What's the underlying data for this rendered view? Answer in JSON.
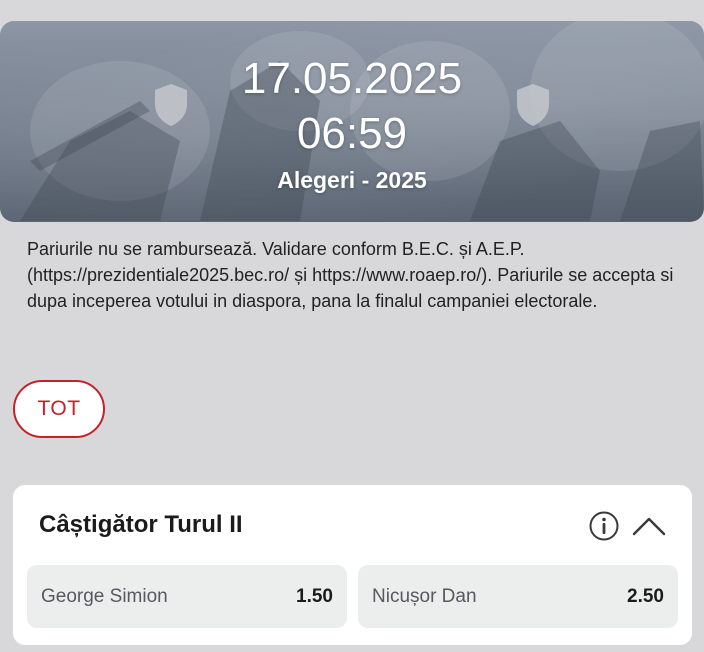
{
  "hero": {
    "date": "17.05.2025",
    "time": "06:59",
    "event_title": "Alegeri - 2025"
  },
  "notice": {
    "text": "Pariurile nu se rambursează. Validare conform B.E.C. și A.E.P. (https://prezidentiale2025.bec.ro/ și https://www.roaep.ro/). Pariurile se accepta si dupa inceperea votului in diaspora, pana la finalul campaniei electorale."
  },
  "filters": {
    "chips": [
      {
        "label": "TOT",
        "selected": true
      }
    ]
  },
  "market": {
    "title": "Câștigător Turul II",
    "info_icon": "info-icon",
    "collapse_icon": "chevron-up-icon",
    "selections": [
      {
        "name": "George Simion",
        "odds": "1.50"
      },
      {
        "name": "Nicușor Dan",
        "odds": "2.50"
      }
    ]
  },
  "colors": {
    "accent": "#c8202a",
    "page_background": "#d8d8da",
    "card_background": "#ffffff",
    "selection_background": "#eceded"
  }
}
